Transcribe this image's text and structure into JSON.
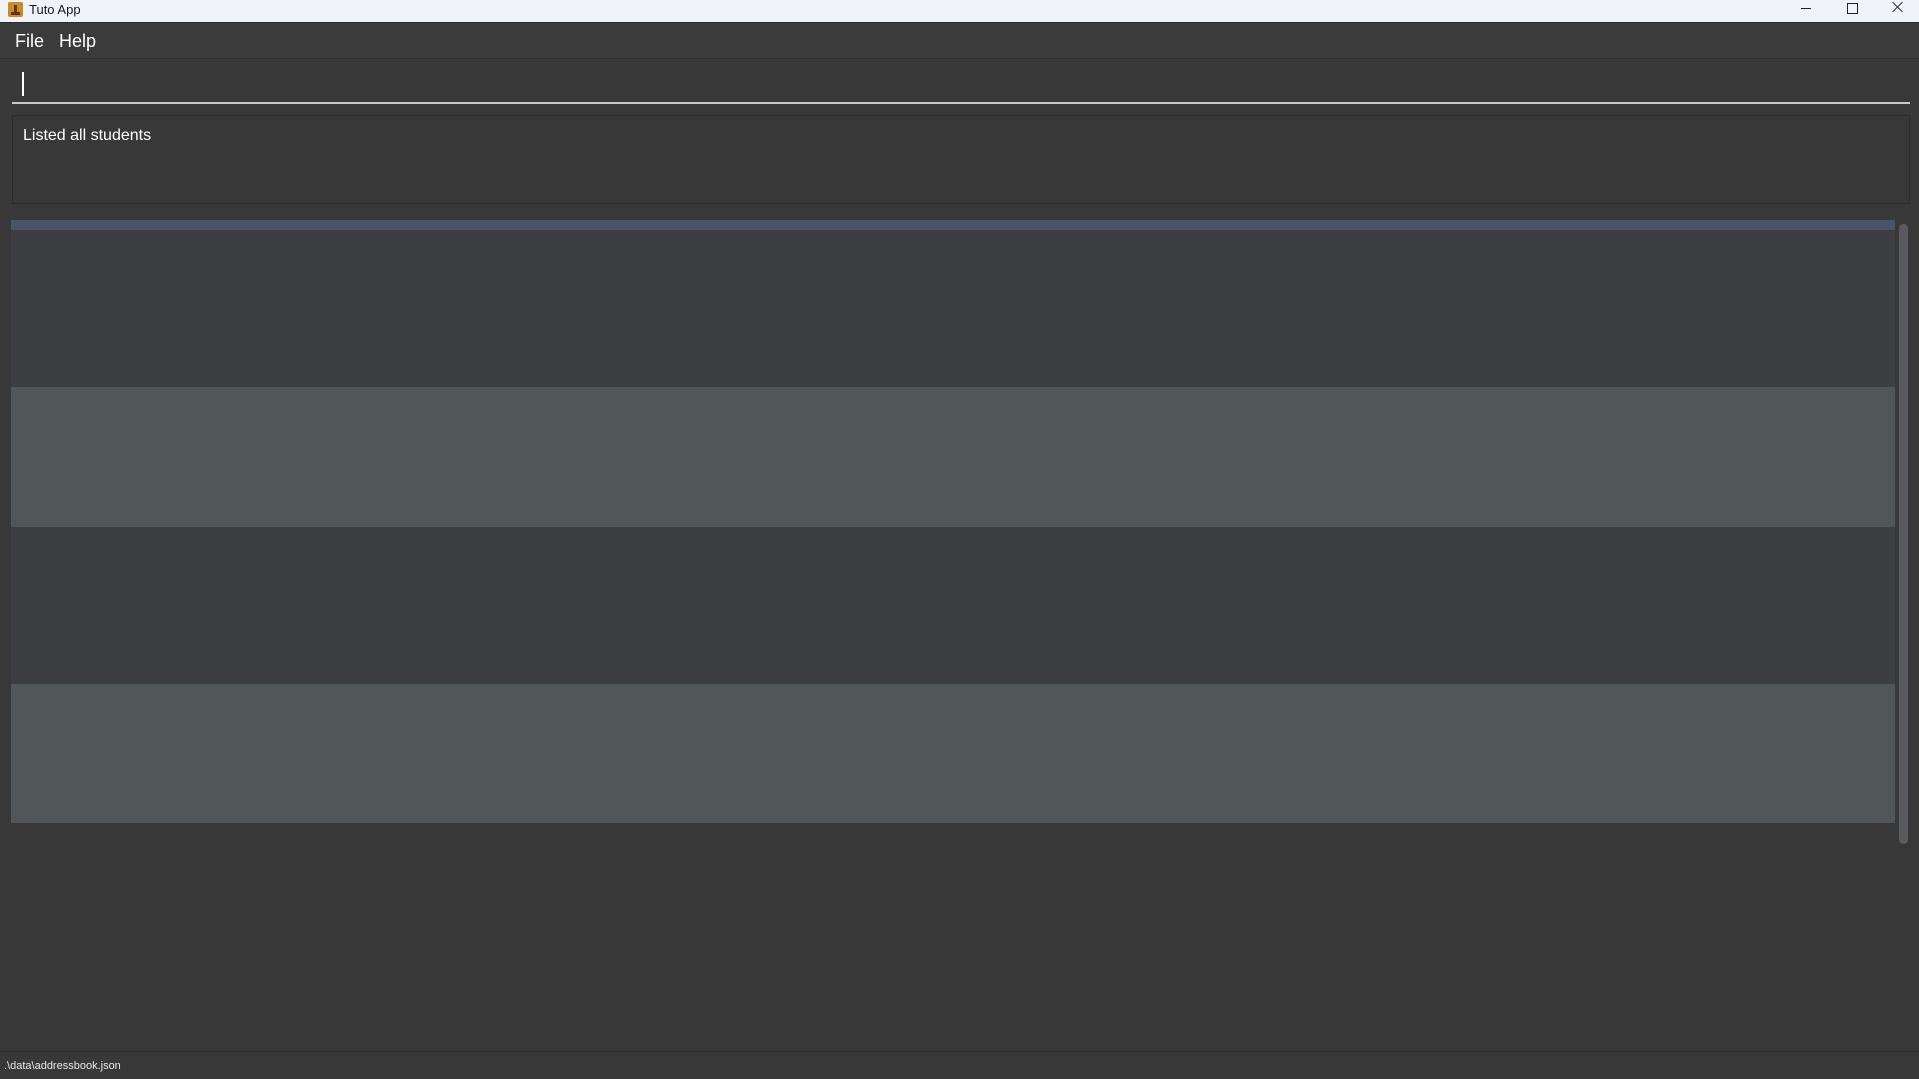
{
  "window": {
    "title": "Tuto App"
  },
  "menu": {
    "items": [
      {
        "label": "File"
      },
      {
        "label": "Help"
      }
    ]
  },
  "command": {
    "value": "",
    "placeholder": ""
  },
  "result": {
    "message": "Listed all students"
  },
  "student_list": {
    "rows": [
      {
        "highlight": false
      },
      {
        "highlight": true
      },
      {
        "highlight": false
      },
      {
        "highlight": true
      }
    ]
  },
  "status": {
    "save_location": ".\\data\\addressbook.json"
  },
  "colors": {
    "background": "#383838",
    "selected_bar": "#4a5367",
    "row_dark": "#3c3e41",
    "row_light": "#515658"
  }
}
